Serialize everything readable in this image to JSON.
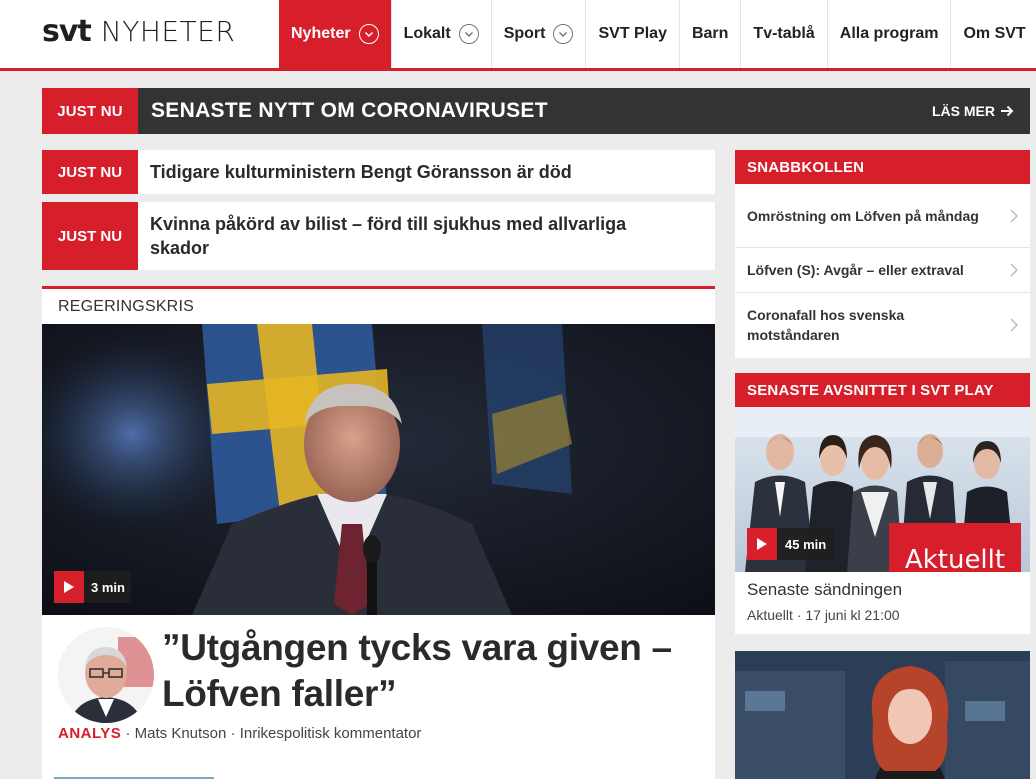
{
  "header": {
    "logo_svt": "svt",
    "logo_nyheter": "NYHETER",
    "nav": [
      {
        "label": "Nyheter",
        "dropdown": true,
        "active": true
      },
      {
        "label": "Lokalt",
        "dropdown": true
      },
      {
        "label": "Sport",
        "dropdown": true
      },
      {
        "label": "SVT Play"
      },
      {
        "label": "Barn"
      },
      {
        "label": "Tv-tablå"
      },
      {
        "label": "Alla program"
      },
      {
        "label": "Om SVT"
      }
    ]
  },
  "banner": {
    "tag": "JUST NU",
    "title": "SENASTE NYTT OM CORONAVIRUSET",
    "more": "LÄS MER"
  },
  "just_nu": [
    {
      "tag": "JUST NU",
      "text": "Tidigare kulturministern Bengt Göransson är död"
    },
    {
      "tag": "JUST NU",
      "text": "Kvinna påkörd av bilist – förd till sjukhus med allvarliga skador"
    }
  ],
  "main_article": {
    "kicker": "REGERINGSKRIS",
    "video_duration": "3 min",
    "headline": "”Utgången tycks vara given – Löfven faller”",
    "byline_type": "ANALYS",
    "byline_sep1": " · ",
    "author": "Mats Knutson",
    "byline_sep2": " · ",
    "author_role": "Inrikespolitisk kommentator"
  },
  "snabbkollen": {
    "title": "SNABBKOLLEN",
    "items": [
      "Omröstning om Löfven på måndag",
      "Löfven (S): Avgår – eller extraval",
      "Coronafall hos svenska motståndaren"
    ]
  },
  "svt_play": {
    "title": "SENASTE AVSNITTET I SVT PLAY",
    "duration": "45 min",
    "logo_text": "Aktuellt",
    "episode_title": "Senaste sändningen",
    "meta": "Aktuellt · 17 juni kl 21:00"
  },
  "colors": {
    "brand_red": "#d71e2b",
    "banner_dark": "#333333",
    "page_bg": "#ececec"
  },
  "icons": {
    "nav_dropdown": "chevron-down-icon",
    "play": "play-icon",
    "arrow": "arrow-right-icon",
    "chevron": "chevron-right-icon"
  }
}
